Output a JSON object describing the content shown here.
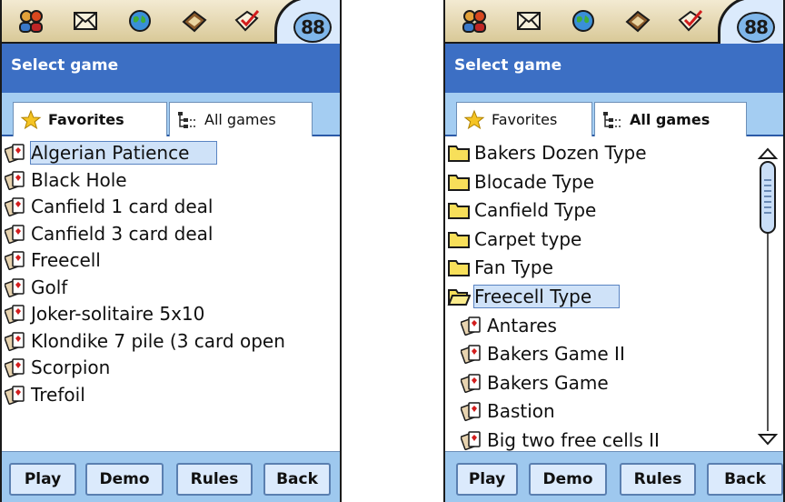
{
  "screens": [
    {
      "title": "Select game",
      "tabs": [
        {
          "label": "Favorites",
          "active": true,
          "icon": "star-icon"
        },
        {
          "label": "All games",
          "active": false,
          "icon": "tree-list-icon"
        }
      ],
      "items": [
        {
          "label": "Algerian Patience",
          "icon": "cards-icon",
          "selected": true
        },
        {
          "label": "Black Hole",
          "icon": "cards-icon"
        },
        {
          "label": "Canfield 1 card deal",
          "icon": "cards-icon"
        },
        {
          "label": "Canfield 3 card deal",
          "icon": "cards-icon"
        },
        {
          "label": "Freecell",
          "icon": "cards-icon"
        },
        {
          "label": "Golf",
          "icon": "cards-icon"
        },
        {
          "label": "Joker-solitaire 5x10",
          "icon": "cards-icon"
        },
        {
          "label": "Klondike 7 pile (3 card open",
          "icon": "cards-icon"
        },
        {
          "label": "Scorpion",
          "icon": "cards-icon"
        },
        {
          "label": "Trefoil",
          "icon": "cards-icon"
        }
      ],
      "buttons": [
        "Play",
        "Demo",
        "Rules",
        "Back"
      ]
    },
    {
      "title": "Select game",
      "tabs": [
        {
          "label": "Favorites",
          "active": false,
          "icon": "star-icon"
        },
        {
          "label": "All games",
          "active": true,
          "icon": "tree-list-icon"
        }
      ],
      "items": [
        {
          "label": "Bakers Dozen Type",
          "icon": "folder-icon"
        },
        {
          "label": "Blocade Type",
          "icon": "folder-icon"
        },
        {
          "label": "Canfield Type",
          "icon": "folder-icon"
        },
        {
          "label": "Carpet type",
          "icon": "folder-icon"
        },
        {
          "label": "Fan Type",
          "icon": "folder-icon"
        },
        {
          "label": "Freecell Type",
          "icon": "folder-open-icon",
          "selected": true
        },
        {
          "label": "Antares",
          "icon": "cards-icon",
          "child": true
        },
        {
          "label": "Bakers Game II",
          "icon": "cards-icon",
          "child": true
        },
        {
          "label": "Bakers Game",
          "icon": "cards-icon",
          "child": true
        },
        {
          "label": "Bastion",
          "icon": "cards-icon",
          "child": true
        },
        {
          "label": "Big two free cells II",
          "icon": "cards-icon",
          "child": true
        }
      ],
      "buttons": [
        "Play",
        "Demo",
        "Rules",
        "Back"
      ]
    }
  ],
  "top_icons": [
    "contacts-icon",
    "mail-icon",
    "web-icon",
    "notes-icon",
    "tasks-icon",
    "menu-icon"
  ],
  "menu_glyph": "88",
  "colors": {
    "title_bar": "#3c6fc4",
    "tab_strip": "#a4cdf2",
    "button_bar": "#9ec8ee",
    "selection": "#cfe2f8"
  }
}
